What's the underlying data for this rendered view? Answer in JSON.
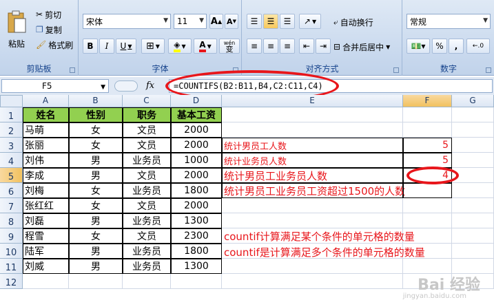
{
  "ribbon": {
    "clipboard": {
      "label": "剪贴板",
      "paste": "粘贴",
      "cut": "剪切",
      "copy": "复制",
      "format_painter": "格式刷"
    },
    "font": {
      "label": "字体",
      "name": "宋体",
      "size": "11",
      "bold": "B",
      "italic": "I",
      "underline": "U",
      "grow": "A",
      "shrink": "A",
      "wen": "wén",
      "wen_char": "变"
    },
    "alignment": {
      "label": "对齐方式",
      "wrap": "自动换行",
      "merge": "合并后居中"
    },
    "number": {
      "label": "数字",
      "format": "常规",
      "percent": "%",
      "comma": ","
    }
  },
  "formula_bar": {
    "name_box": "F5",
    "fx": "fx",
    "formula": "=COUNTIFS(B2:B11,B4,C2:C11,C4)"
  },
  "columns": [
    "A",
    "B",
    "C",
    "D",
    "E",
    "F",
    "G"
  ],
  "rows": [
    "1",
    "2",
    "3",
    "4",
    "5",
    "6",
    "7",
    "8",
    "9",
    "10",
    "11",
    "12"
  ],
  "table": {
    "headers": [
      "姓名",
      "性别",
      "职务",
      "基本工资"
    ],
    "records": [
      [
        "马萌",
        "女",
        "文员",
        "2000"
      ],
      [
        "张丽",
        "女",
        "文员",
        "2000"
      ],
      [
        "刘伟",
        "男",
        "业务员",
        "1000"
      ],
      [
        "李成",
        "男",
        "文员",
        "2000"
      ],
      [
        "刘梅",
        "女",
        "业务员",
        "1800"
      ],
      [
        "张红红",
        "女",
        "文员",
        "2000"
      ],
      [
        "刘磊",
        "男",
        "业务员",
        "1300"
      ],
      [
        "程雪",
        "女",
        "文员",
        "2300"
      ],
      [
        "陆军",
        "男",
        "业务员",
        "1800"
      ],
      [
        "刘威",
        "男",
        "业务员",
        "1300"
      ]
    ]
  },
  "stats": [
    {
      "label": "统计男员工人数",
      "value": "5"
    },
    {
      "label": "统计业务员人数",
      "value": "5"
    },
    {
      "label": "统计男员工业务员人数",
      "value": "4"
    },
    {
      "label": "统计男员工业务员工资超过1500的人数",
      "value": ""
    }
  ],
  "notes": [
    "countif计算满足某个条件的单元格的数量",
    "countif是计算满足多个条件的单元格的数量"
  ],
  "watermark": {
    "main": "Bai 经验",
    "sub": "jingyan.baidu.com"
  },
  "colors": {
    "accent_red": "#e8161b",
    "header_green": "#92d050"
  }
}
